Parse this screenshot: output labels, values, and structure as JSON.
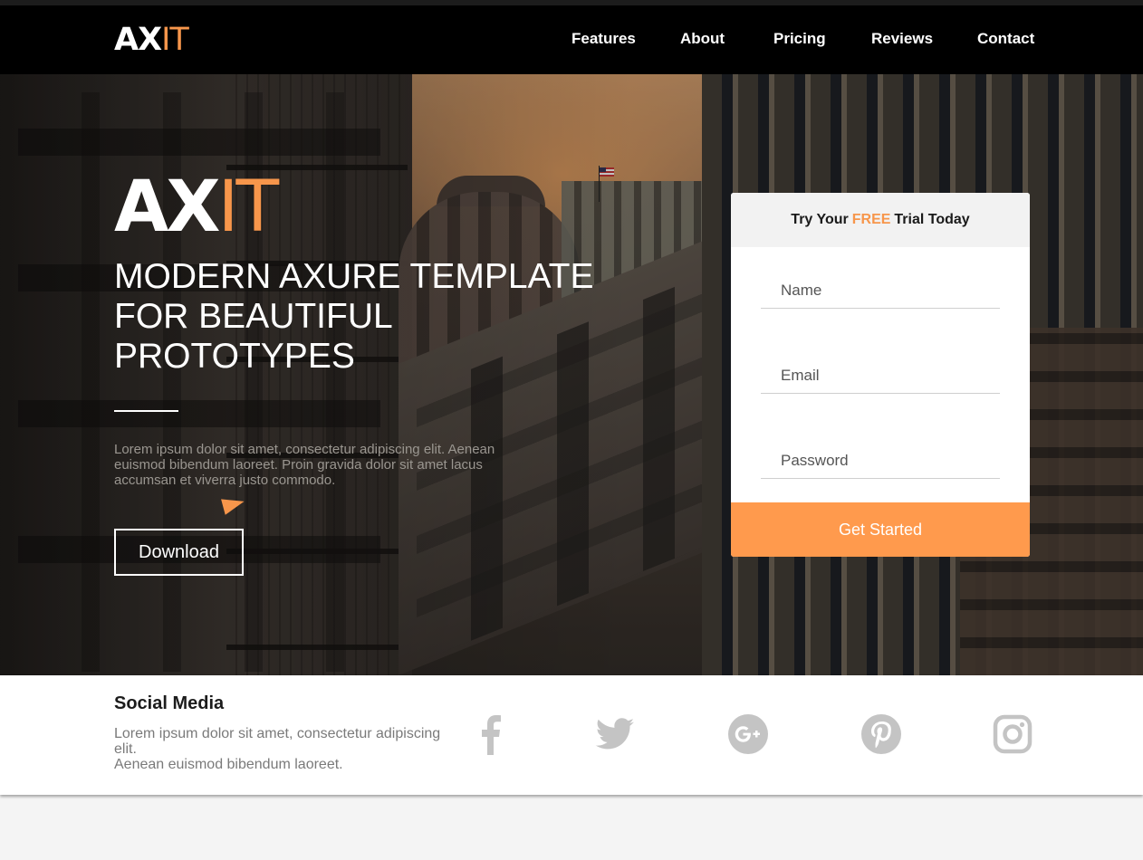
{
  "nav": {
    "logo_ax": "AX",
    "logo_it": "IT",
    "links": [
      "Features",
      "About",
      "Pricing",
      "Reviews",
      "Contact"
    ]
  },
  "hero": {
    "logo_ax": "AX",
    "logo_it": "IT",
    "title_lines": [
      "MODERN AXURE TEMPLATE",
      "FOR BEAUTIFUL",
      "PROTOTYPES"
    ],
    "text_lines": [
      "Lorem ipsum dolor sit amet, consectetur adipiscing elit. Aenean",
      "euismod bibendum laoreet. Proin gravida dolor sit amet lacus",
      "accumsan et viverra justo commodo."
    ],
    "download_label": "Download"
  },
  "signup": {
    "heading_before": "Try Your",
    "heading_free": "FREE",
    "heading_after": "Trial Today",
    "name_placeholder": "Name",
    "email_placeholder": "Email",
    "password_placeholder": "Password",
    "button_label": "Get Started"
  },
  "social": {
    "title": "Social Media",
    "text_lines": [
      "Lorem ipsum dolor sit amet, consectetur adipiscing",
      "elit.",
      "Aenean euismod bibendum laoreet."
    ],
    "icons": [
      "facebook-icon",
      "twitter-icon",
      "google-plus-icon",
      "pinterest-icon",
      "instagram-icon"
    ]
  },
  "colors": {
    "accent": "#f7964b",
    "button": "#ff9a4d",
    "nav_bg": "#000000",
    "icon_gray": "#c4c4c4"
  }
}
